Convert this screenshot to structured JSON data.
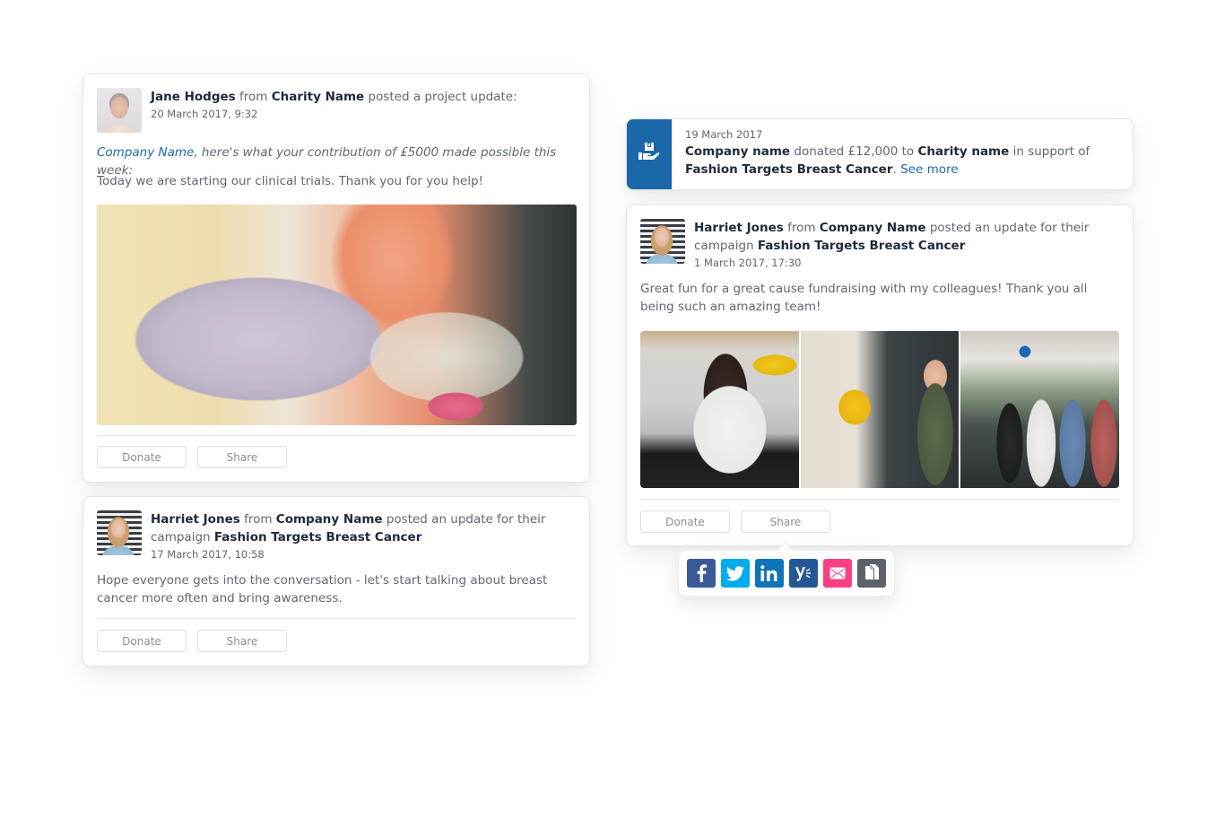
{
  "colors": {
    "brand_blue": "#1a68a8",
    "link": "#1a6aa8",
    "heading": "#1e2a3a",
    "body": "#5f6770",
    "facebook": "#3b5998",
    "twitter": "#00aced",
    "linkedin": "#0e76b8",
    "yammer": "#245795",
    "email": "#fc3f82",
    "copy": "#5d6269"
  },
  "feed": {
    "project_update": {
      "author": "Jane Hodges",
      "from_word": "from",
      "organisation": "Charity Name",
      "action": "posted a project update:",
      "timestamp": "20 March 2017, 9:32",
      "intro_link": "Company Name",
      "intro_rest": ", here's what your contribution of £5000 made possible this week:",
      "body": "Today we are starting our clinical trials. Thank you for you help!",
      "image_alt": "Gloved hand holding a petri dish",
      "donate_label": "Donate",
      "share_label": "Share"
    },
    "campaign_update_1": {
      "author": "Harriet Jones",
      "from_word": "from",
      "organisation": "Company Name",
      "action": "posted an update for their campaign",
      "campaign": "Fashion Targets Breast Cancer",
      "timestamp": "17 March 2017, 10:58",
      "body": "Hope everyone gets into the conversation - let's start talking about breast cancer more often and bring awareness.",
      "donate_label": "Donate",
      "share_label": "Share"
    },
    "donation_notice": {
      "icon": "donation-hand-icon",
      "date": "19 March 2017",
      "donor": "Company name",
      "verb": "donated £12,000 to",
      "recipient": "Charity name",
      "support_phrase": "in support of",
      "campaign": "Fashion Targets Breast Cancer",
      "period": ".",
      "see_more": "See more"
    },
    "campaign_update_2": {
      "author": "Harriet Jones",
      "from_word": "from",
      "organisation": "Company Name",
      "action": "posted an update for their campaign",
      "campaign": "Fashion Targets Breast Cancer",
      "timestamp": "1 March 2017, 17:30",
      "body": "Great fun for a great cause fundraising with my colleagues! Thank you all being such an amazing team!",
      "gallery": [
        {
          "alt": "Woman browsing a flower truck"
        },
        {
          "alt": "Woman laughing next to sunflowers at flower truck"
        },
        {
          "alt": "Group of women holding flowers"
        }
      ],
      "donate_label": "Donate",
      "share_label": "Share"
    },
    "share_menu": {
      "options": [
        {
          "name": "Facebook",
          "icon": "facebook-icon"
        },
        {
          "name": "Twitter",
          "icon": "twitter-icon"
        },
        {
          "name": "LinkedIn",
          "icon": "linkedin-icon"
        },
        {
          "name": "Yammer",
          "icon": "yammer-icon"
        },
        {
          "name": "Email",
          "icon": "email-icon"
        },
        {
          "name": "Copy link",
          "icon": "copy-icon"
        }
      ]
    }
  }
}
